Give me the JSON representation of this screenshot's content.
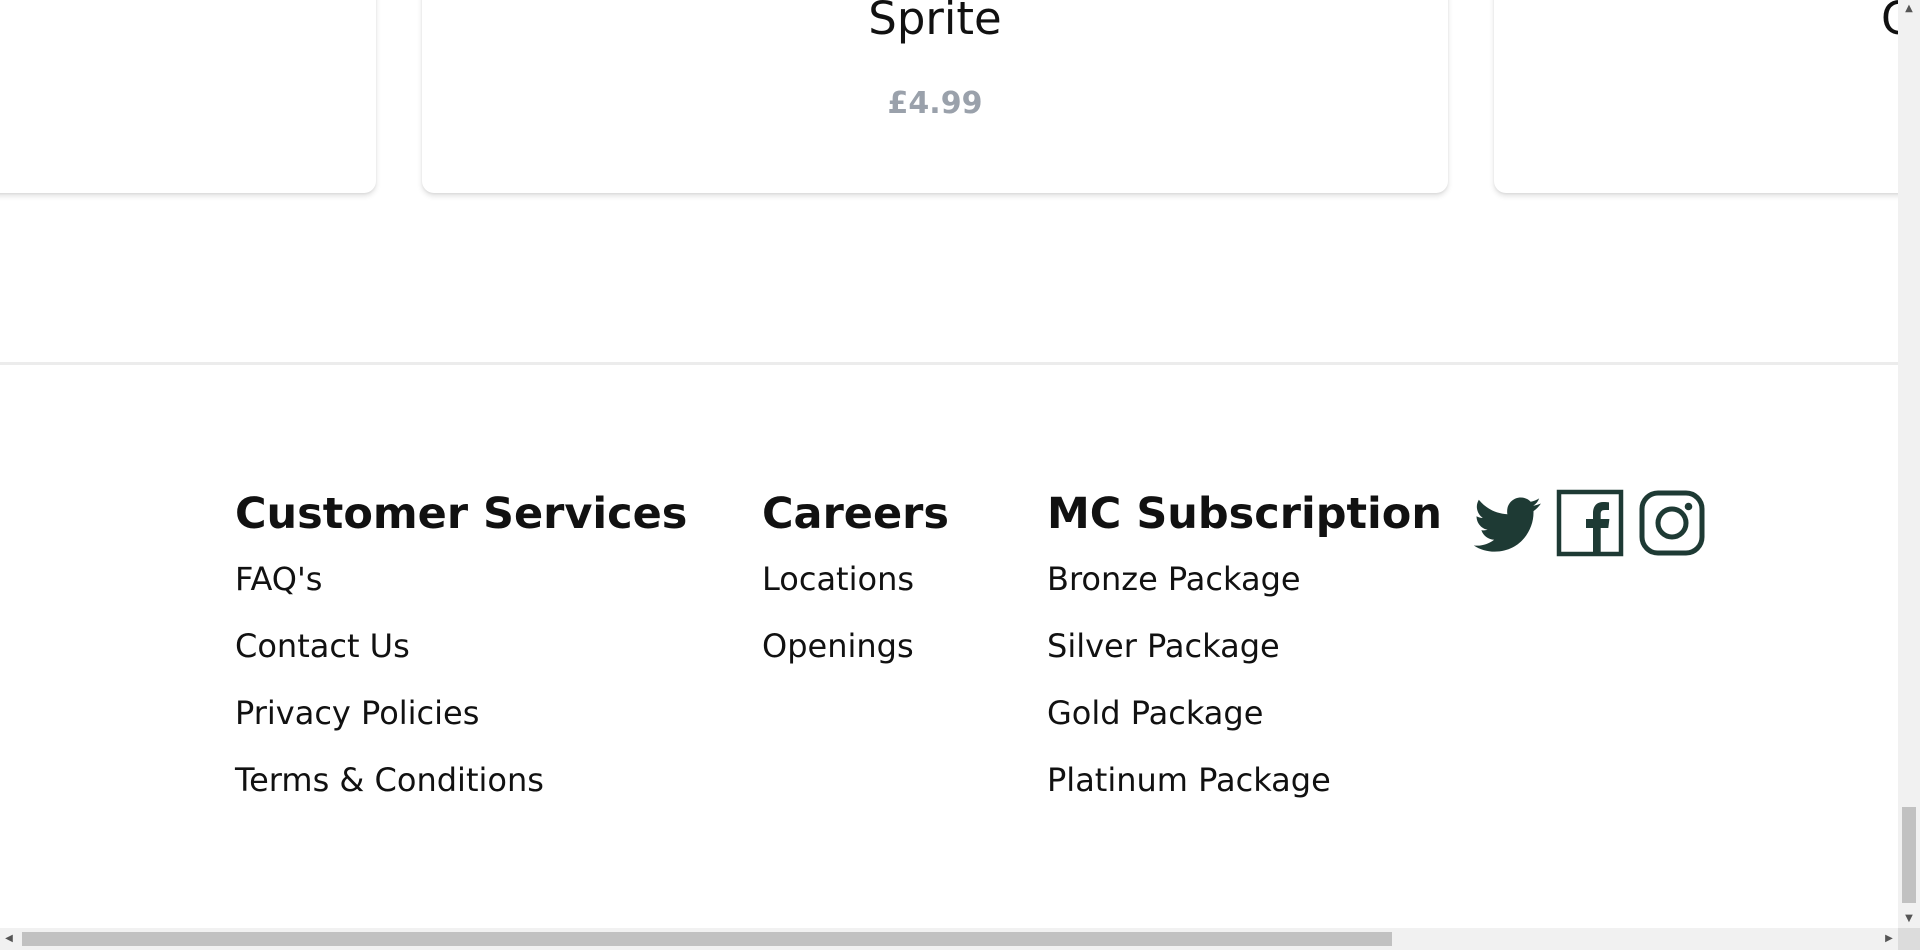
{
  "products": {
    "left_card": {
      "title": "",
      "price": ""
    },
    "middle_card": {
      "title": "Sprite",
      "price": "£4.99"
    },
    "right_card": {
      "title": "C",
      "price": ""
    }
  },
  "footer": {
    "customer_services": {
      "heading": "Customer Services",
      "links": [
        "FAQ's",
        "Contact Us",
        "Privacy Policies",
        "Terms & Conditions"
      ]
    },
    "careers": {
      "heading": "Careers",
      "links": [
        "Locations",
        "Openings"
      ]
    },
    "mc_subscription": {
      "heading": "MC Subscription",
      "links": [
        "Bronze Package",
        "Silver Package",
        "Gold Package",
        "Platinum Package"
      ]
    },
    "socials": [
      {
        "icon": "twitter-icon"
      },
      {
        "icon": "facebook-icon"
      },
      {
        "icon": "instagram-icon"
      }
    ]
  },
  "colors": {
    "social_icon": "#1e3a34",
    "price_text": "#9aa1ab"
  }
}
